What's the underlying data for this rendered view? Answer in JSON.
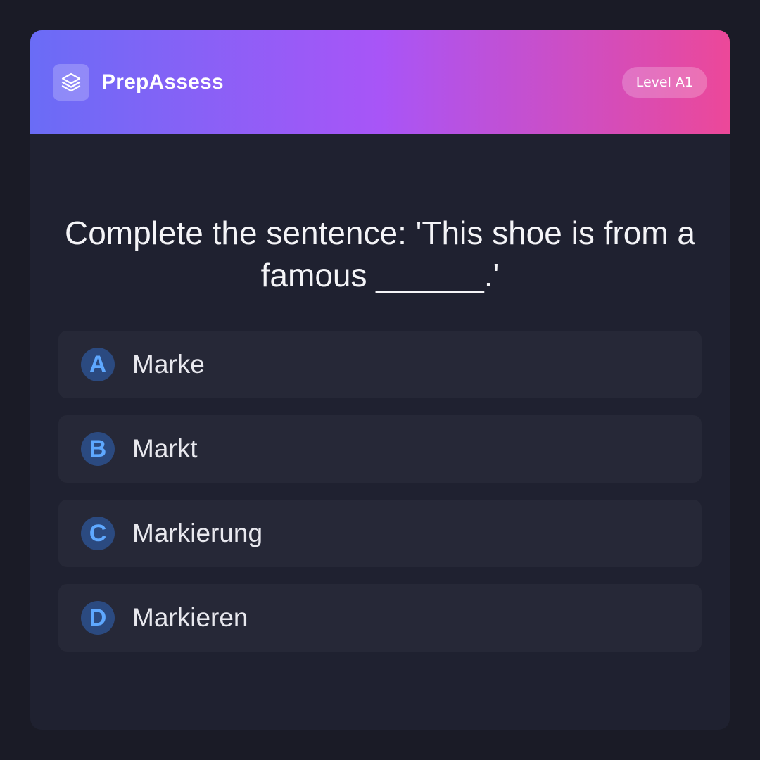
{
  "app": {
    "name": "PrepAssess",
    "logo_icon": "layers-icon",
    "level": "Level A1"
  },
  "question": {
    "text": "Complete the sentence: 'This shoe is from a famous ______.'"
  },
  "options": [
    {
      "letter": "A",
      "text": "Marke"
    },
    {
      "letter": "B",
      "text": "Markt"
    },
    {
      "letter": "C",
      "text": "Markierung"
    },
    {
      "letter": "D",
      "text": "Markieren"
    }
  ],
  "colors": {
    "background": "#1a1b26",
    "card": "#1f2130",
    "option_bg": "#262837",
    "letter_bg": "#2b4a80",
    "letter_fg": "#5ea8ff",
    "gradient_start": "#6a6cf6",
    "gradient_mid": "#a855f7",
    "gradient_end": "#ec4899"
  }
}
